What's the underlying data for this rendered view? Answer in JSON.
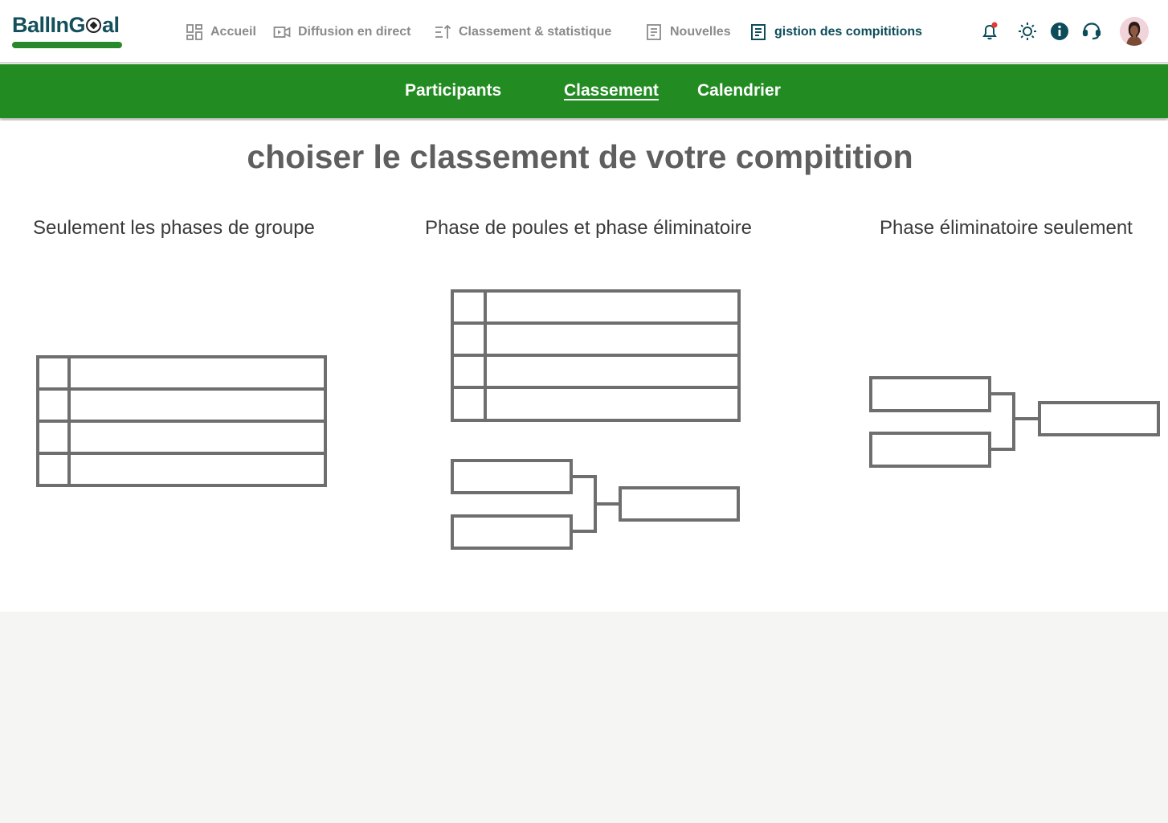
{
  "logo": {
    "text_before": "BallInG",
    "text_after": "al"
  },
  "nav": {
    "items": [
      {
        "label": "Accueil",
        "icon": "dashboard-icon"
      },
      {
        "label": "Diffusion en direct",
        "icon": "video-icon"
      },
      {
        "label": "Classement & statistique",
        "icon": "sort-icon"
      },
      {
        "label": "Nouvelles",
        "icon": "news-icon"
      },
      {
        "label": "gistion des compititions",
        "icon": "document-icon",
        "active": true
      }
    ],
    "right_icons": [
      "notification-bell-icon",
      "theme-sun-icon",
      "info-icon",
      "support-headset-icon",
      "user-avatar"
    ]
  },
  "subnav": {
    "tabs": [
      {
        "label": "Participants"
      },
      {
        "label": "Classement",
        "active": true
      },
      {
        "label": "Calendrier"
      }
    ]
  },
  "main": {
    "title": "choiser le classement de votre compitition",
    "options": [
      {
        "label": "Seulement les phases de groupe",
        "diagram": "group-table"
      },
      {
        "label": "Phase de poules et phase éliminatoire",
        "diagram": "group-table-and-bracket"
      },
      {
        "label": "Phase éliminatoire seulement",
        "diagram": "knockout-bracket"
      }
    ]
  },
  "colors": {
    "brand_green": "#228b22",
    "brand_teal": "#0d4d5a",
    "notification_dot": "#e53935",
    "diagram_stroke": "#6e6e6e"
  }
}
